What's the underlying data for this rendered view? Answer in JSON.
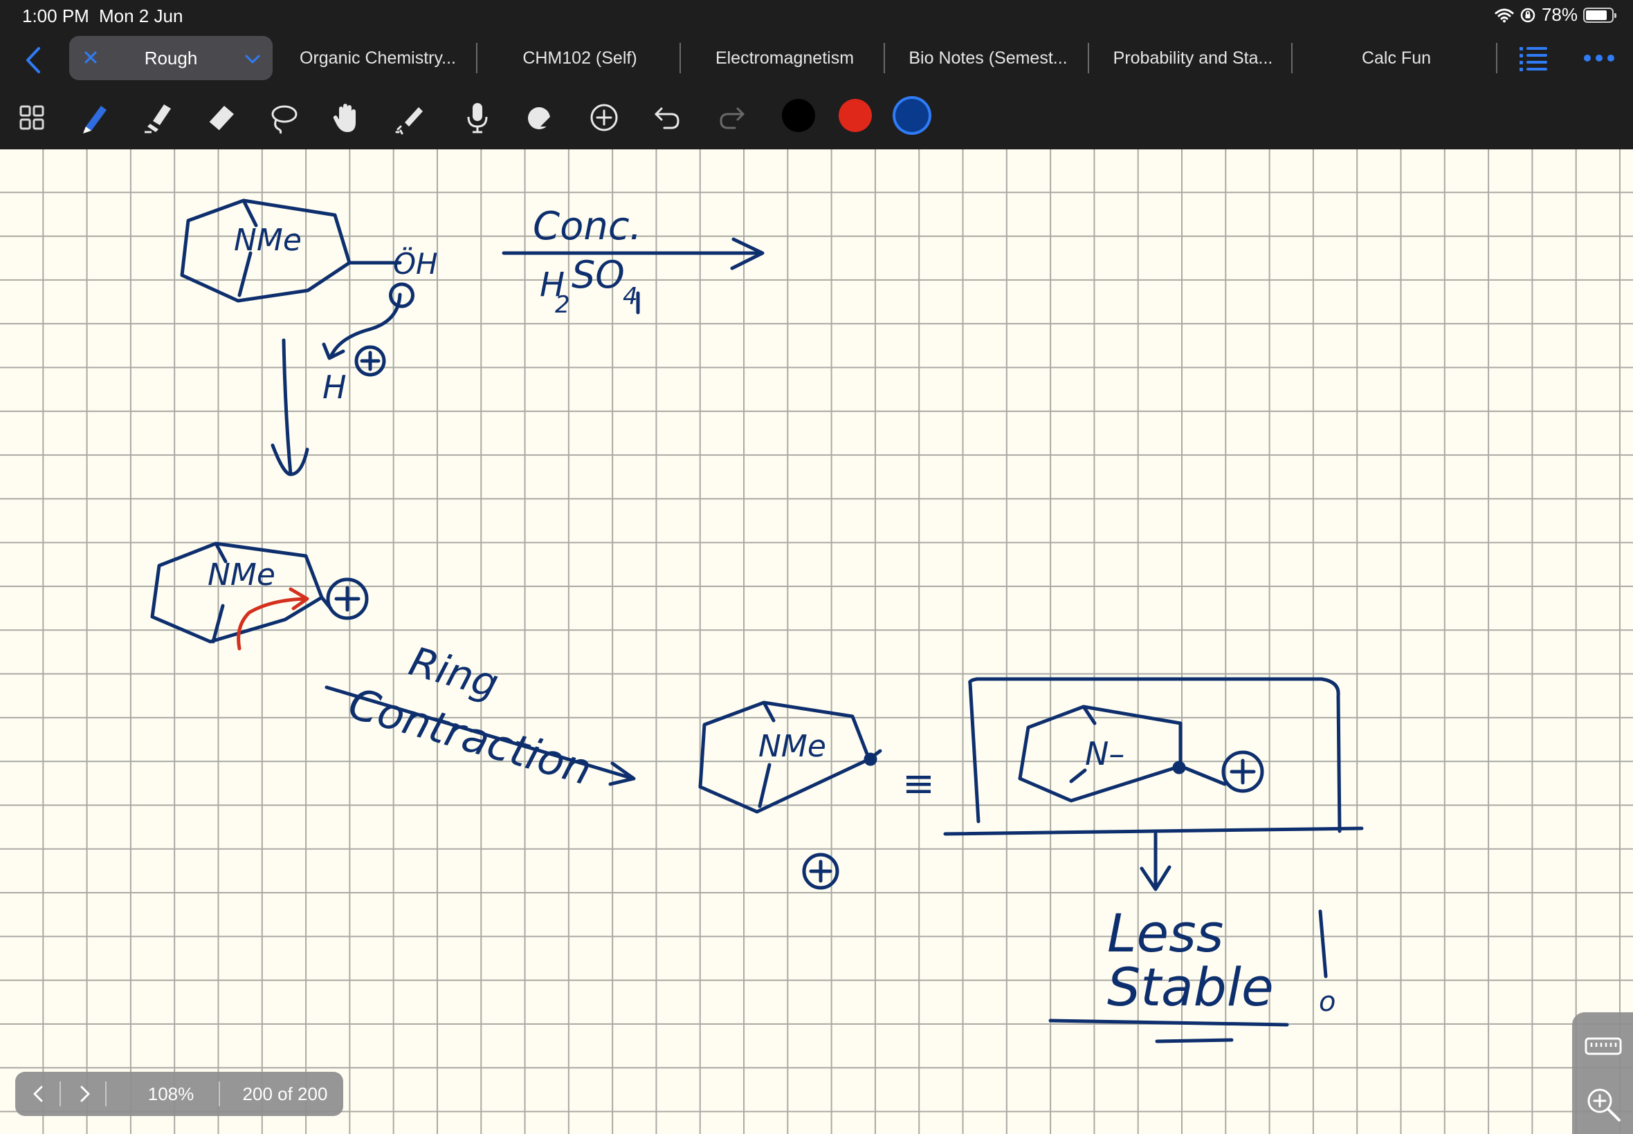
{
  "status": {
    "time": "1:00 PM",
    "date": "Mon 2 Jun",
    "battery": "78%",
    "icons": [
      "wifi-icon",
      "orientation-lock-icon",
      "battery-icon"
    ]
  },
  "tabs": {
    "active": {
      "label": "Rough"
    },
    "items": [
      {
        "label": "Organic Chemistry..."
      },
      {
        "label": "CHM102 (Self)"
      },
      {
        "label": "Electromagnetism"
      },
      {
        "label": "Bio Notes (Semest..."
      },
      {
        "label": "Probability and Sta..."
      },
      {
        "label": "Calc Fun"
      }
    ]
  },
  "toolbar": {
    "tools": [
      "thumbnails-icon",
      "pen-icon",
      "highlighter-icon",
      "eraser-icon",
      "lasso-icon",
      "hand-icon",
      "laser-pointer-icon",
      "microphone-icon",
      "shapes-icon",
      "add-icon",
      "undo-icon",
      "redo-icon"
    ],
    "selected_tool": "pen-icon",
    "colors": [
      "#000000",
      "#e0281a",
      "#0a3a8c"
    ],
    "selected_color": "#0a3a8c"
  },
  "note": {
    "ink_color": "#0e2f6e",
    "accent_ink_color": "#d4301e",
    "text": {
      "nme1": "NMe",
      "oh": "ÖH",
      "conc": "Conc.",
      "h2": "H",
      "h2sub": "2",
      "so4": "SO",
      "so4sub": "4",
      "hplus": "H",
      "nme2": "NMe",
      "ring": "Ring",
      "contraction": "Contraction",
      "nme3": "NMe",
      "equiv": "≡",
      "nminus": "N–",
      "less": "Less",
      "stable": "Stable",
      "excl": "!"
    }
  },
  "pagenav": {
    "zoom": "108%",
    "pages": "200 of 200"
  },
  "sidepanel": [
    "keyboard-icon",
    "zoom-icon"
  ]
}
